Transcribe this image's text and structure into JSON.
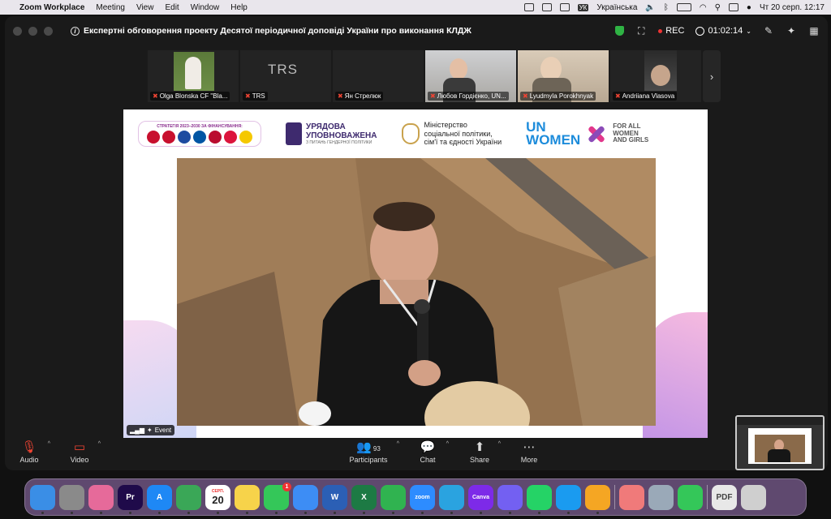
{
  "menubar": {
    "app": "Zoom Workplace",
    "items": [
      "Meeting",
      "View",
      "Edit",
      "Window",
      "Help"
    ],
    "keyboard_badge": "УК",
    "keyboard_label": "Українська",
    "clock": "Чт 20 серп.  12:17"
  },
  "titlebar": {
    "title": "Експертні обговорення проекту Десятої періодичної доповіді України про виконання КЛДЖ",
    "rec_label": "REC",
    "timer": "01:02:14"
  },
  "participants": [
    {
      "name": "Olga Blonska CF \"Bla..."
    },
    {
      "name": "TRS",
      "logo": "TRS"
    },
    {
      "name": "Ян Стрелюк"
    },
    {
      "name": "Любов Гордієнко, UN..."
    },
    {
      "name": "Lyudmyla Porokhnyak"
    },
    {
      "name": "Andriiana Vlasova"
    }
  ],
  "share": {
    "flags_caption": "СТРАТЕГІЯ 2023–2030 ЗА ФІНАНСУВАННЯ:",
    "flag_colors": [
      "#c8102e",
      "#c8102e",
      "#1e4ba0",
      "#0055a4",
      "#ba0c2f",
      "#dc143c",
      "#f5c800"
    ],
    "uu_line1": "УРЯДОВА",
    "uu_line2": "УПОВНОВАЖЕНА",
    "uu_sub": "З ПИТАНЬ ГЕНДЕРНОЇ ПОЛІТИКИ",
    "ministry_line1": "Міністерство",
    "ministry_line2": "соціальної політики,",
    "ministry_line3": "сім'ї та єдності України",
    "un_line1": "UN",
    "un_line2": "WOMEN",
    "faw_line1": "FOR ALL",
    "faw_line2": "WOMEN",
    "faw_line3": "AND GIRLS",
    "event_label": "Event"
  },
  "toolbar": {
    "audio": "Audio",
    "video": "Video",
    "participants": "Participants",
    "participants_count": "93",
    "chat": "Chat",
    "share": "Share",
    "more": "More"
  },
  "dock": {
    "items": [
      {
        "name": "finder",
        "label": "",
        "color": "#3a8ee6"
      },
      {
        "name": "system-settings",
        "label": "",
        "color": "#8a8a8a"
      },
      {
        "name": "launchpad",
        "label": "",
        "color": "#e66a9a"
      },
      {
        "name": "premiere-pro",
        "label": "Pr",
        "color": "#1f0a4a"
      },
      {
        "name": "app-store",
        "label": "A",
        "color": "#1e88f5"
      },
      {
        "name": "chrome",
        "label": "",
        "color": "#3aa757"
      },
      {
        "name": "calendar",
        "label": "20",
        "month": "СЕРП.",
        "color": "#ffffff"
      },
      {
        "name": "notes",
        "label": "",
        "color": "#f7d34a"
      },
      {
        "name": "messages",
        "label": "",
        "color": "#34c759",
        "badge": "1"
      },
      {
        "name": "mail",
        "label": "",
        "color": "#3d8df5"
      },
      {
        "name": "word",
        "label": "W",
        "color": "#2b5fb5"
      },
      {
        "name": "excel",
        "label": "X",
        "color": "#1d7a44"
      },
      {
        "name": "numbers",
        "label": "",
        "color": "#30b350"
      },
      {
        "name": "zoom",
        "label": "zoom",
        "color": "#2d8cff"
      },
      {
        "name": "telegram",
        "label": "",
        "color": "#2aa3e0"
      },
      {
        "name": "canva",
        "label": "Canva",
        "color": "#7d2ae8"
      },
      {
        "name": "viber",
        "label": "",
        "color": "#7360f2"
      },
      {
        "name": "whatsapp",
        "label": "",
        "color": "#25d366"
      },
      {
        "name": "safari",
        "label": "",
        "color": "#1a9bf0"
      },
      {
        "name": "pages",
        "label": "",
        "color": "#f5a623"
      },
      {
        "name": "photos",
        "label": "",
        "color": "#f07a7a"
      },
      {
        "name": "preview",
        "label": "",
        "color": "#9aa9b8"
      },
      {
        "name": "facetime",
        "label": "",
        "color": "#34c759"
      },
      {
        "name": "pdf-document",
        "label": "PDF",
        "color": "#e8e8e8"
      },
      {
        "name": "trash",
        "label": "",
        "color": "#cfcfcf"
      }
    ]
  }
}
